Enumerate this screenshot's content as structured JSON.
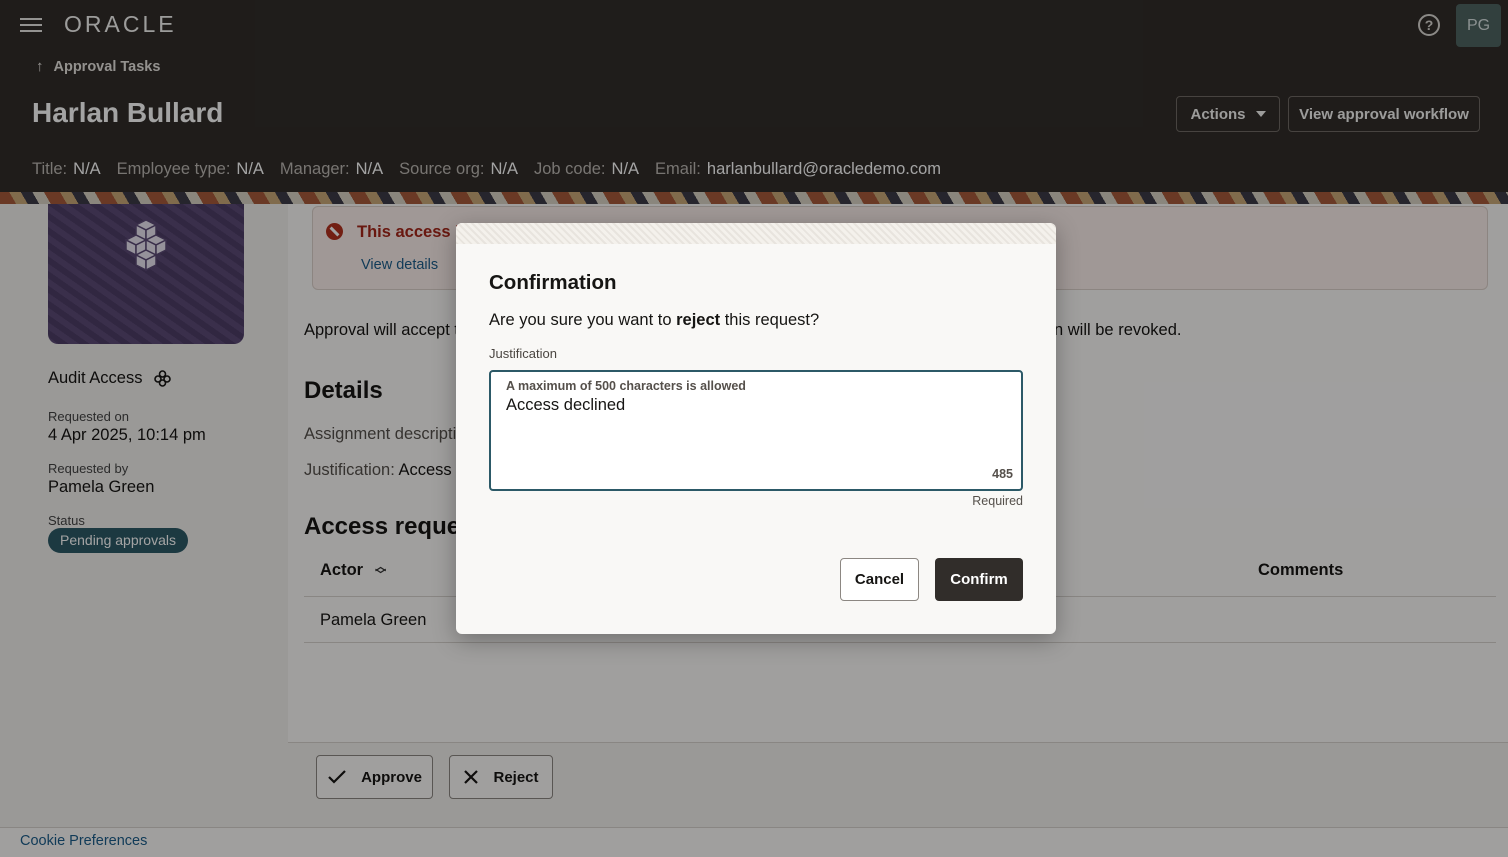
{
  "header": {
    "logo": "ORACLE",
    "avatar_initials": "PG",
    "breadcrumb": "Approval Tasks",
    "title": "Harlan Bullard",
    "actions_label": "Actions",
    "workflow_label": "View approval workflow",
    "meta": [
      {
        "label": "Title:",
        "value": "N/A"
      },
      {
        "label": "Employee type:",
        "value": "N/A"
      },
      {
        "label": "Manager:",
        "value": "N/A"
      },
      {
        "label": "Source org:",
        "value": "N/A"
      },
      {
        "label": "Job code:",
        "value": "N/A"
      },
      {
        "label": "Email:",
        "value": "harlanbullard@oracledemo.com"
      }
    ]
  },
  "sidebar": {
    "item_name": "Audit Access",
    "requested_on_label": "Requested on",
    "requested_on": "4 Apr 2025, 10:14 pm",
    "requested_by_label": "Requested by",
    "requested_by": "Pamela Green",
    "status_label": "Status",
    "status": "Pending approvals"
  },
  "main": {
    "alert_title": "This access i",
    "alert_link": "View details",
    "intro_left": "Approval will accept t",
    "intro_right": "n will be revoked.",
    "details_heading": "Details",
    "assignment_label": "Assignment descripti",
    "justification_label": "Justification:",
    "justification_value": "Access",
    "access_heading": "Access reque",
    "col_actor": "Actor",
    "col_comments": "Comments",
    "row_actor": "Pamela Green"
  },
  "footer": {
    "approve_label": "Approve",
    "reject_label": "Reject",
    "cookie_label": "Cookie Preferences"
  },
  "dialog": {
    "title": "Confirmation",
    "msg_pre": "Are you sure you want to ",
    "msg_bold": "reject",
    "msg_post": " this request?",
    "field_label": "Justification",
    "hint": "A maximum of 500 characters is allowed",
    "value": "Access declined",
    "remaining": "485",
    "required": "Required",
    "cancel_label": "Cancel",
    "confirm_label": "Confirm"
  }
}
